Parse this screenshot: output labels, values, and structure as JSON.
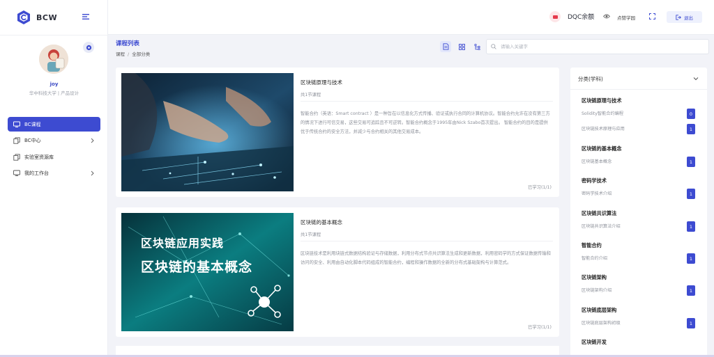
{
  "app": {
    "logo_text": "BCW"
  },
  "user": {
    "name": "joy",
    "org": "华中科技大学 | 产品设计"
  },
  "sidebar": {
    "items": [
      {
        "label": "BC课程",
        "icon": "monitor-icon",
        "active": true,
        "chevron": false
      },
      {
        "label": "BC中心",
        "icon": "copy-icon",
        "active": false,
        "chevron": true
      },
      {
        "label": "实验室资源库",
        "icon": "copy-icon",
        "active": false,
        "chevron": false
      },
      {
        "label": "我的工作台",
        "icon": "desktop-icon",
        "active": false,
        "chevron": true
      }
    ]
  },
  "header": {
    "balance_label": "DQC余额",
    "school_link": "点赞学园",
    "logout_label": "退出"
  },
  "page": {
    "title": "课程列表",
    "breadcrumb": [
      "课程",
      "全部分类"
    ]
  },
  "search": {
    "placeholder": "请输入关键字",
    "value": ""
  },
  "courses": [
    {
      "title": "区块链原理与技术",
      "count": "共1节课程",
      "description": "智能合约（英语：Smart contract ）是一种旨在以信息化方式传播、验证或执行合同的计算机协议。智能合约允许在没有第三方的情况下进行可信交易，这些交易可追踪且不可逆转。智能合约概念于1995年由Nick Szabo首次提出。 智能合约的目的是提供优于传统合约的安全方法，并减少与合约相关的其他交易成本。",
      "progress": "已学习(1/1)"
    },
    {
      "title": "区块链的基本概念",
      "count": "共1节课程",
      "description": "区块链技术是利用块链式数据结构验证与存储数据，利用分布式节点共识算法生成和更新数据，利用密码学的方式保证数据传输和访问的安全、利用由自动化脚本代码组成的智能合约，编程和操作数据的全新的分布式基础架构与计算范式。",
      "progress": "已学习(1/1)",
      "banner_line1": "区块链应用实践",
      "banner_line2": "区块链的基本概念"
    }
  ],
  "categories": {
    "header": "分类(学科)",
    "groups": [
      {
        "title": "区块链原理与技术",
        "items": [
          {
            "label": "Solidity智能合约编程",
            "count": "0"
          },
          {
            "label": "区块链技术原理与应用",
            "count": "1"
          }
        ]
      },
      {
        "title": "区块链的基本概念",
        "items": [
          {
            "label": "区块链基本概念",
            "count": "1"
          }
        ]
      },
      {
        "title": "密码学技术",
        "items": [
          {
            "label": "密码学技术介绍",
            "count": "1"
          }
        ]
      },
      {
        "title": "区块链共识算法",
        "items": [
          {
            "label": "区块链共识算法介绍",
            "count": "1"
          }
        ]
      },
      {
        "title": "智能合约",
        "items": [
          {
            "label": "智能合约介绍",
            "count": "1"
          }
        ]
      },
      {
        "title": "区块链架构",
        "items": [
          {
            "label": "区块链架构介绍",
            "count": "1"
          }
        ]
      },
      {
        "title": "区块链底层架构",
        "items": [
          {
            "label": "区块链底层架构初级",
            "count": "1"
          }
        ]
      },
      {
        "title": "区块链开发",
        "items": []
      }
    ]
  },
  "colors": {
    "accent": "#3d4bd1",
    "background": "#f2f3f8"
  }
}
